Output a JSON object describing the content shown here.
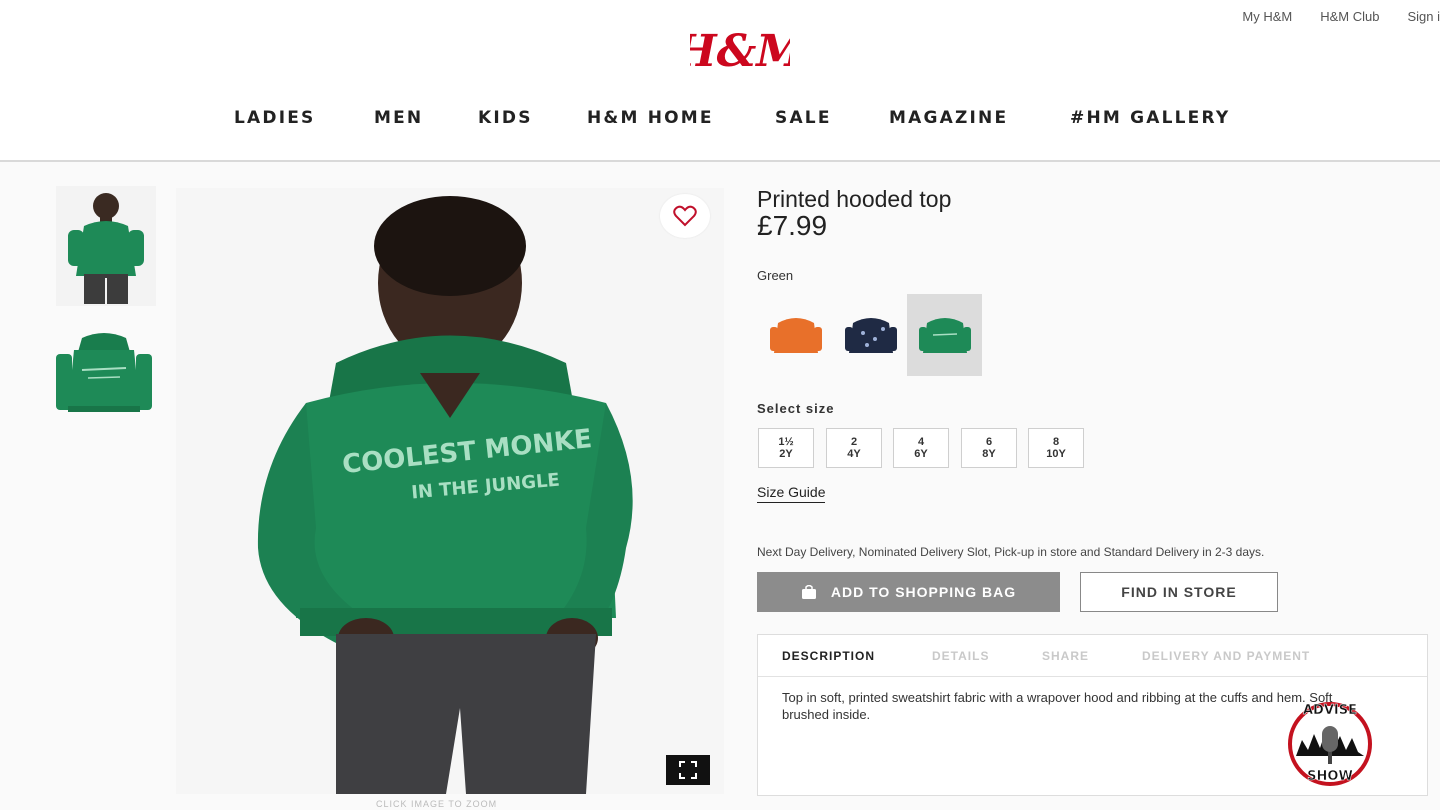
{
  "header": {
    "top_links": [
      "My H&M",
      "H&M Club",
      "Sign i"
    ],
    "logo_text": "H&M",
    "nav": [
      "LADIES",
      "MEN",
      "KIDS",
      "H&M HOME",
      "SALE",
      "MAGAZINE",
      "#HM GALLERY"
    ]
  },
  "gallery": {
    "zoom_hint": "CLICK IMAGE TO ZOOM"
  },
  "hoodie_print": {
    "line1": "COOLEST MONKE",
    "line2": "IN THE JUNGLE"
  },
  "product": {
    "title": "Printed hooded top",
    "price": "£7.99",
    "color_label": "Green",
    "swatches": [
      {
        "name": "orange",
        "color": "#e8702a"
      },
      {
        "name": "navy",
        "color": "#1f2a44"
      },
      {
        "name": "green",
        "color": "#1e8a57",
        "selected": true
      }
    ],
    "size_label": "Select size",
    "sizes": [
      {
        "top": "1½",
        "bottom": "2Y"
      },
      {
        "top": "2",
        "bottom": "4Y"
      },
      {
        "top": "4",
        "bottom": "6Y"
      },
      {
        "top": "6",
        "bottom": "8Y"
      },
      {
        "top": "8",
        "bottom": "10Y"
      }
    ],
    "size_guide": "Size Guide",
    "delivery": "Next Day Delivery, Nominated Delivery Slot, Pick-up in store and Standard Delivery in 2-3 days.",
    "add_to_bag": "ADD TO SHOPPING BAG",
    "find_in_store": "FIND IN STORE"
  },
  "description": {
    "tabs": [
      "DESCRIPTION",
      "DETAILS",
      "SHARE",
      "DELIVERY AND PAYMENT"
    ],
    "text": "Top in soft, printed sweatshirt fabric with a wrapover hood and ribbing at the cuffs and hem. Soft brushed inside."
  },
  "watermark": {
    "top": "ADVISE",
    "bottom": "SHOW"
  },
  "colors": {
    "brand_red": "#cc071e",
    "hoodie_green": "#1e8a57",
    "button_gray": "#8c8c8c"
  }
}
